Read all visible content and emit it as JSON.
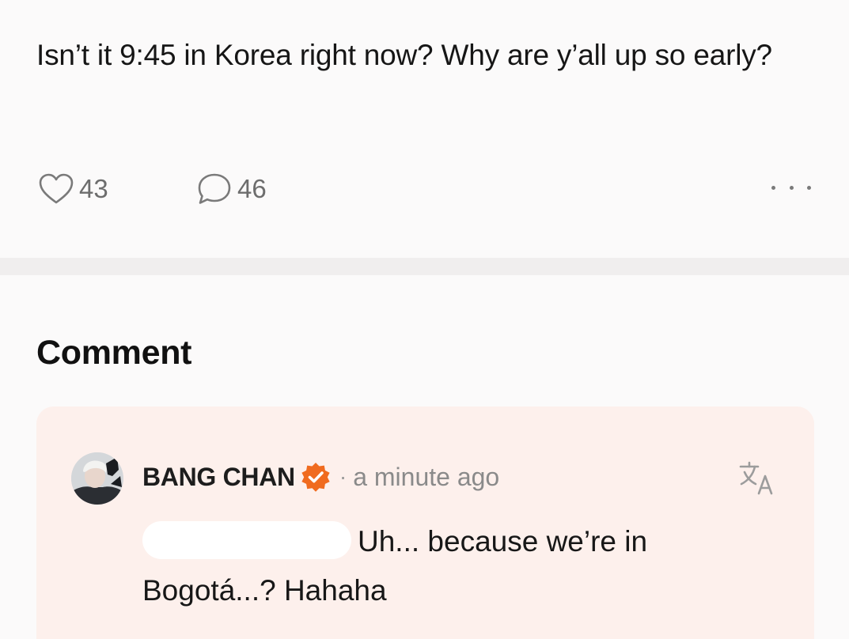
{
  "post": {
    "text": "Isn’t it 9:45 in Korea right now? Why are y’all up so early?",
    "likes": "43",
    "comments": "46",
    "more_label": "···"
  },
  "comments_section": {
    "heading": "Comment",
    "comment": {
      "author": "BANG CHAN",
      "separator": "·",
      "time": "a minute ago",
      "body": "Uh... because we’re in Bogotá...? Hahaha",
      "verified_icon": "verified-badge-icon",
      "translate_icon": "translate-icon"
    }
  },
  "colors": {
    "background": "#fbfafa",
    "divider": "#f0eeee",
    "comment_card": "#fdf0ec",
    "verified_badge": "#f06b1f",
    "muted_text": "#8a8a8a"
  }
}
